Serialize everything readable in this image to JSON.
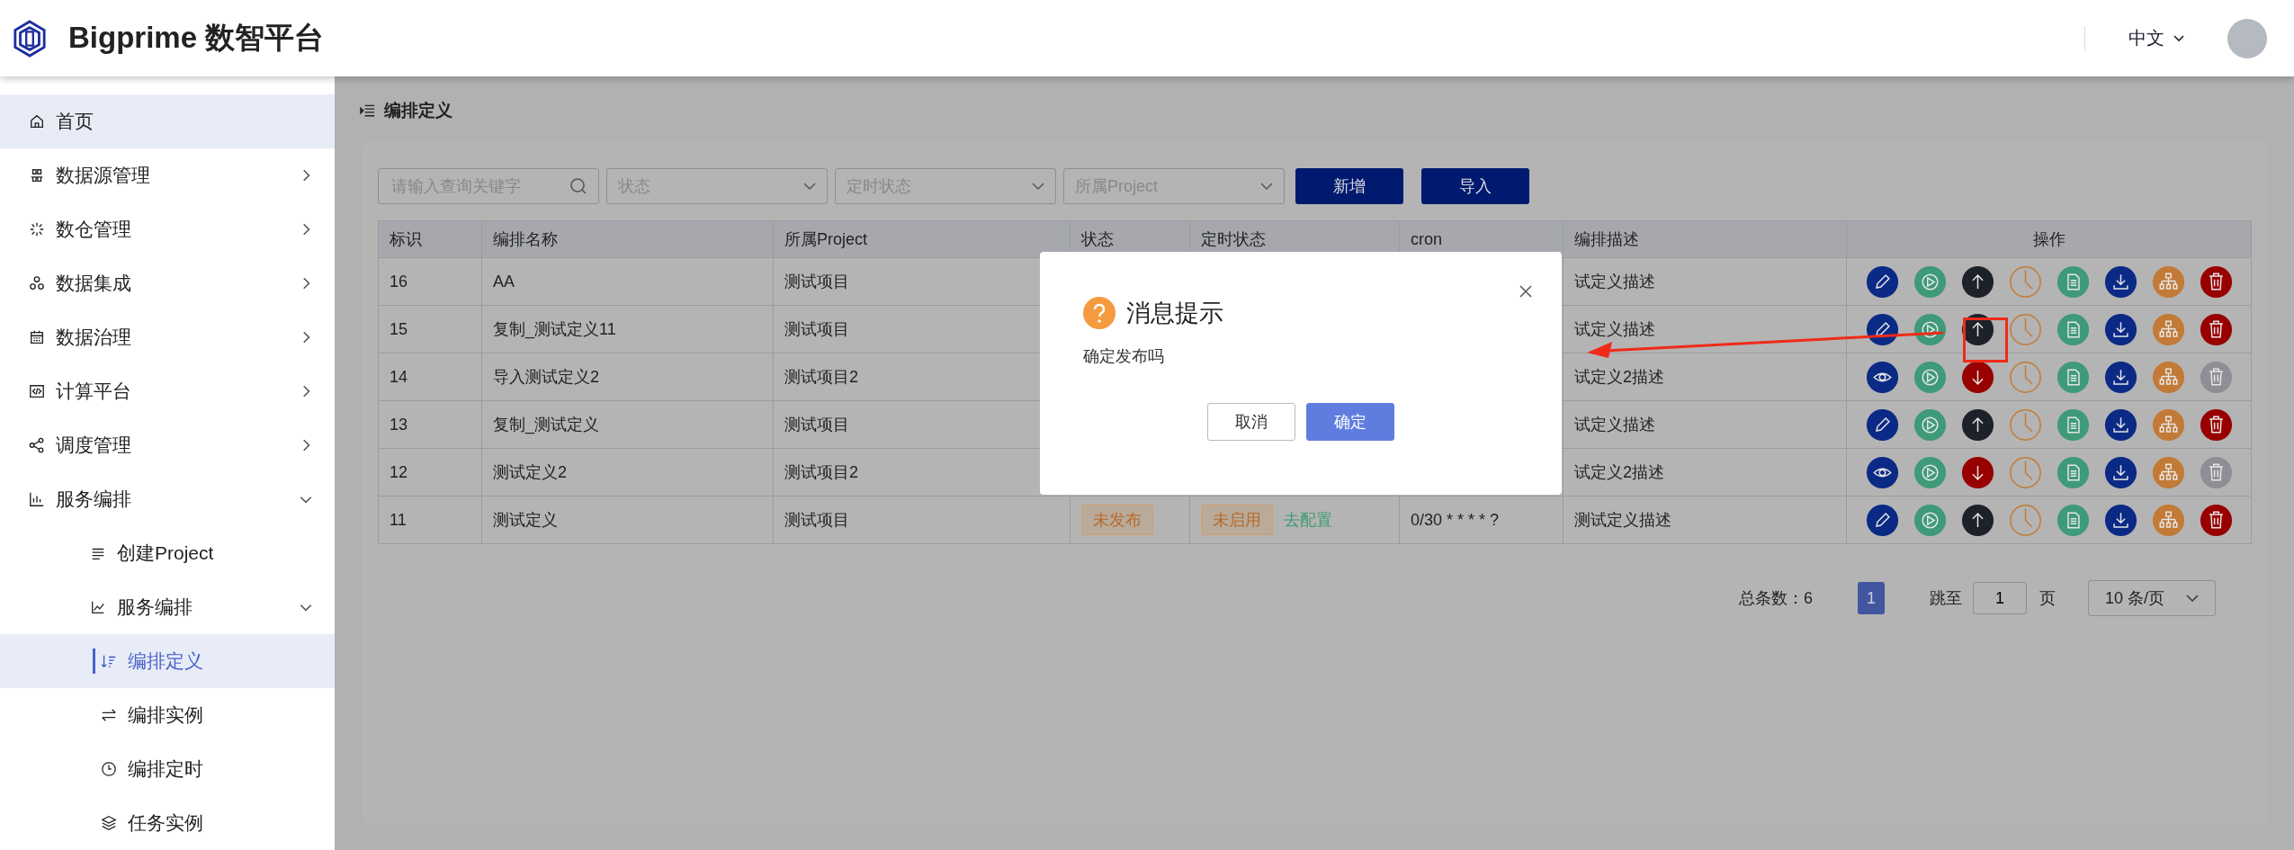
{
  "header": {
    "title": "Bigprime 数智平台",
    "language": "中文"
  },
  "sidebar": {
    "items": [
      {
        "label": "首页",
        "kind": "home",
        "selected": true
      },
      {
        "label": "数据源管理",
        "kind": "nodes",
        "selected": false,
        "expanded": false
      },
      {
        "label": "数仓管理",
        "kind": "spark",
        "selected": false,
        "expanded": false
      },
      {
        "label": "数据集成",
        "kind": "triad",
        "selected": false,
        "expanded": false
      },
      {
        "label": "数据治理",
        "kind": "calendar",
        "selected": false,
        "expanded": false
      },
      {
        "label": "计算平台",
        "kind": "code",
        "selected": false,
        "expanded": false
      },
      {
        "label": "调度管理",
        "kind": "share",
        "selected": false,
        "expanded": false
      },
      {
        "label": "服务编排",
        "kind": "bars",
        "selected": false,
        "expanded": true,
        "children": [
          {
            "label": "创建Project",
            "kind": "lines",
            "selected": false
          },
          {
            "label": "服务编排",
            "kind": "chart",
            "selected": false,
            "expanded": true,
            "children": [
              {
                "label": "编排定义",
                "kind": "sort",
                "selected": true
              },
              {
                "label": "编排实例",
                "kind": "swap",
                "selected": false
              },
              {
                "label": "编排定时",
                "kind": "clock",
                "selected": false
              },
              {
                "label": "任务实例",
                "kind": "layers",
                "selected": false
              }
            ]
          }
        ]
      }
    ]
  },
  "breadcrumb": "编排定义",
  "filters": {
    "search": {
      "placeholder": "请输入查询关键字"
    },
    "selects": [
      {
        "placeholder": "状态"
      },
      {
        "placeholder": "定时状态"
      },
      {
        "placeholder": "所属Project"
      }
    ],
    "buttons": [
      "新增",
      "导入"
    ]
  },
  "table": {
    "columns": [
      "标识",
      "编排名称",
      "所属Project",
      "状态",
      "定时状态",
      "cron",
      "编排描述",
      "操作"
    ],
    "rows": [
      {
        "id": "16",
        "name": "AA",
        "project": "测试项目",
        "description": "试定义描述",
        "published": false
      },
      {
        "id": "15",
        "name": "复制_测试定义11",
        "project": "测试项目",
        "description": "试定义描述",
        "published": false
      },
      {
        "id": "14",
        "name": "导入测试定义2",
        "project": "测试项目2",
        "description": "试定义2描述",
        "published": true
      },
      {
        "id": "13",
        "name": "复制_测试定义",
        "project": "测试项目",
        "description": "试定义描述",
        "published": false
      },
      {
        "id": "12",
        "name": "测试定义2",
        "project": "测试项目2",
        "description": "试定义2描述",
        "published": true
      },
      {
        "id": "11",
        "name": "测试定义",
        "project": "测试项目",
        "status": "未发布",
        "timer_status": "未启用",
        "timer_link": "去配置",
        "cron": "0/30 * * * * ?",
        "description": "测试定义描述",
        "published": false
      }
    ]
  },
  "pagination": {
    "total": "总条数：6",
    "pages": [
      {
        "label": "1",
        "selected": true
      }
    ],
    "jump_label": "跳至",
    "jump_value": "1",
    "page_unit": "页",
    "page_size": "10 条/页"
  },
  "dialog": {
    "title": "消息提示",
    "message": "确定发布吗",
    "buttons": [
      {
        "label": "取消",
        "primary": false
      },
      {
        "label": "确定",
        "primary": true
      }
    ]
  }
}
